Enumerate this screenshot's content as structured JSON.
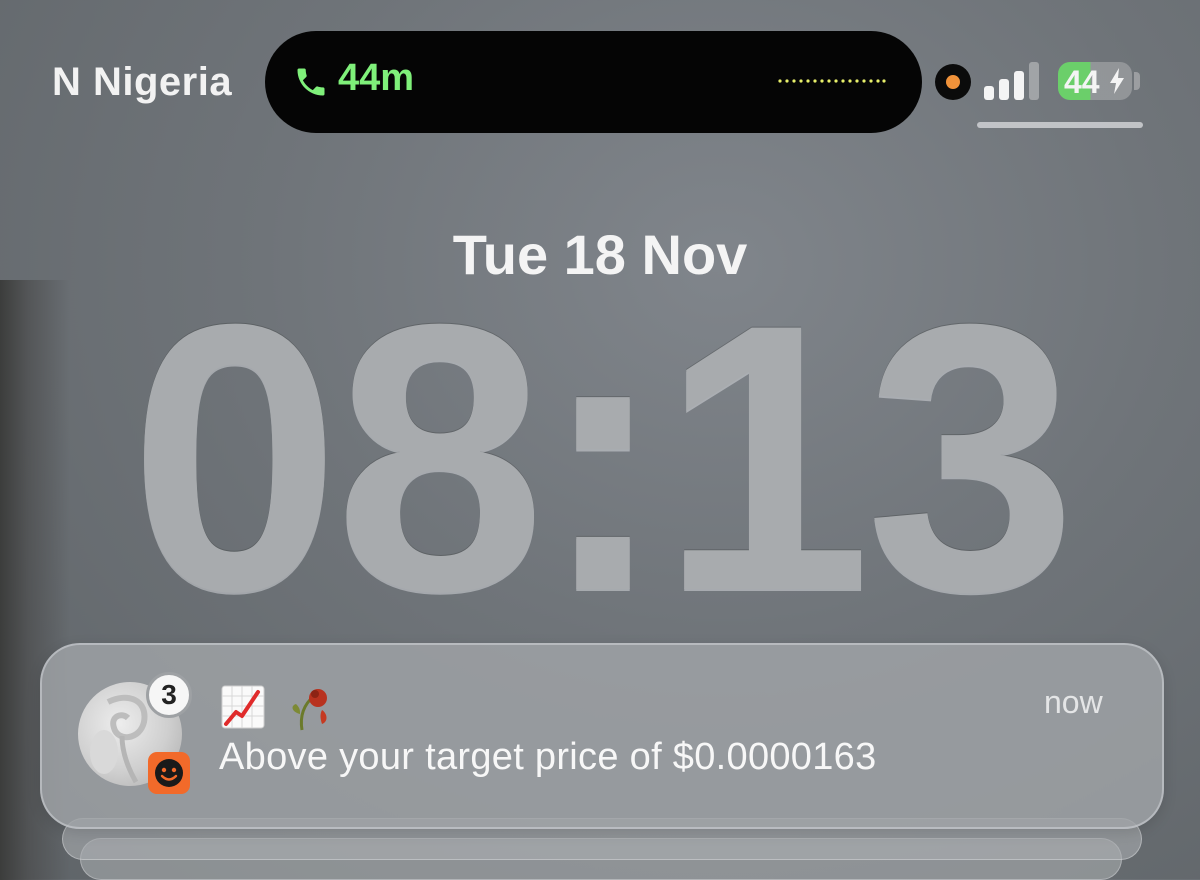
{
  "status_bar": {
    "carrier": "N Nigeria",
    "call_time": "44m",
    "battery_percent": "44",
    "battery_level": 0.44,
    "signal_bars": 3,
    "icons": [
      "phone-icon",
      "audio-wave-icon",
      "recording-indicator-icon",
      "signal-icon",
      "battery-charging-icon"
    ]
  },
  "lock_screen": {
    "date": "Tue 18 Nov",
    "time": "08:13"
  },
  "notification": {
    "badge_count": "3",
    "emojis": [
      "chart-increasing-emoji",
      "wilted-flower-emoji"
    ],
    "time": "now",
    "body": "Above your target price of $0.0000163",
    "app_icon": "smiley-app-icon"
  },
  "colors": {
    "call_green": "#7ff07a",
    "recording_orange": "#f0923a",
    "battery_green": "#6bcf6a",
    "app_badge_orange": "#f26a2a"
  }
}
